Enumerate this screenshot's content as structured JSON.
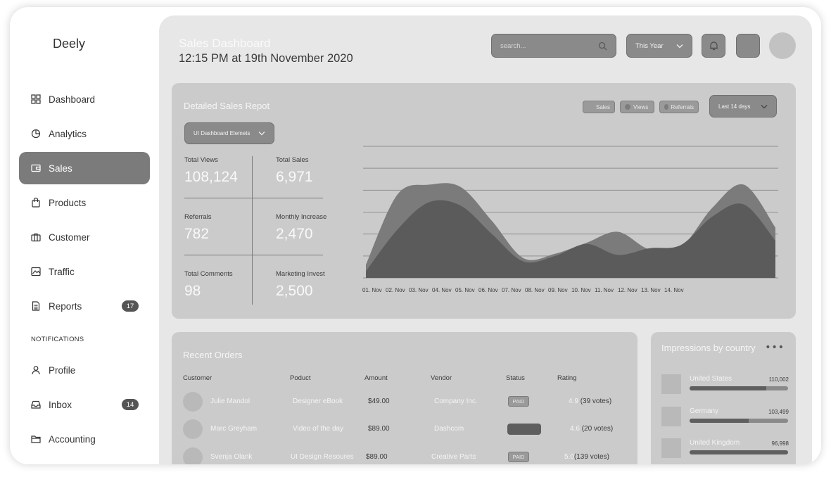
{
  "brand": "Deely",
  "sidebar": {
    "items": [
      {
        "label": "Dashboard",
        "icon": "grid-icon"
      },
      {
        "label": "Analytics",
        "icon": "pie-icon"
      },
      {
        "label": "Sales",
        "icon": "wallet-icon",
        "active": true
      },
      {
        "label": "Products",
        "icon": "bag-icon"
      },
      {
        "label": "Customer",
        "icon": "briefcase-icon"
      },
      {
        "label": "Traffic",
        "icon": "image-icon"
      },
      {
        "label": "Reports",
        "icon": "document-icon",
        "badge": "17"
      }
    ],
    "section_label": "NOTIFICATIONS",
    "notifications": [
      {
        "label": "Profile",
        "icon": "user-icon"
      },
      {
        "label": "Inbox",
        "icon": "inbox-icon",
        "badge": "14"
      },
      {
        "label": "Accounting",
        "icon": "folder-icon"
      }
    ]
  },
  "header": {
    "title": "Sales Dashboard",
    "time": "12:15 PM at 19th November 2020",
    "search_placeholder": "search...",
    "period": "This Year"
  },
  "sales_report": {
    "title": "Detailed Sales Repot",
    "filter": "UI Dashboard Elemets",
    "range": "Last 14 days",
    "legend": [
      "Sales",
      "Views",
      "Referrals"
    ],
    "stats": [
      {
        "label": "Total Views",
        "value": "108,124"
      },
      {
        "label": "Total Sales",
        "value": "6,971"
      },
      {
        "label": "Referrals",
        "value": "782"
      },
      {
        "label": "Monthly Increase",
        "value": "2,470"
      },
      {
        "label": "Total Comments",
        "value": "98"
      },
      {
        "label": "Marketing Invest",
        "value": "2,500"
      }
    ]
  },
  "chart_data": {
    "type": "area",
    "x": [
      "01. Nov",
      "02. Nov",
      "03. Nov",
      "04. Nov",
      "05. Nov",
      "06. Nov",
      "07. Nov",
      "08. Nov",
      "09. Nov",
      "10. Nov",
      "11. Nov",
      "12. Nov",
      "13. Nov",
      "14. Nov"
    ],
    "series": [
      {
        "values": [
          0.6,
          3.8,
          4.25,
          4.15,
          2.6,
          0.9,
          1.1,
          1.6,
          2.1,
          1.3,
          1.4,
          3.2,
          4.25,
          2.3
        ],
        "color": "#7b7b7b"
      },
      {
        "values": [
          0.3,
          2.2,
          3.45,
          3.3,
          2.0,
          0.75,
          1.0,
          1.55,
          1.05,
          1.35,
          1.5,
          2.8,
          3.35,
          1.7
        ],
        "color": "#5b5b5b"
      }
    ],
    "ylim": [
      0,
      6
    ],
    "grid": true
  },
  "orders": {
    "title": "Recent Orders",
    "columns": [
      "Customer",
      "Poduct",
      "Amount",
      "Vendor",
      "Status",
      "Rating"
    ],
    "rows": [
      {
        "customer": "Julie Mandol",
        "product": "Designer eBook",
        "amount": "$49.00",
        "vendor": "Company Inc.",
        "status": "PAID",
        "rating": "4.9",
        "votes": "(39 votes)"
      },
      {
        "customer": "Marc Greyham",
        "product": "Video of the day",
        "amount": "$89.00",
        "vendor": "Dashcom",
        "status": "",
        "rating": "4.6",
        "votes": "(20 votes)"
      },
      {
        "customer": "Svenja Olank",
        "product": "UI Design Resoures",
        "amount": "$89.00",
        "vendor": "Creative Parts",
        "status": "PAID",
        "rating": "5.0",
        "votes": "(139 votes)"
      }
    ]
  },
  "countries": {
    "title": "Impressions by country",
    "items": [
      {
        "name": "United States",
        "value": "110,002",
        "share": 0.78
      },
      {
        "name": "Germany",
        "value": "103,499",
        "share": 0.6
      },
      {
        "name": "United Kingdom",
        "value": "96,998",
        "share": 1.0
      }
    ]
  }
}
